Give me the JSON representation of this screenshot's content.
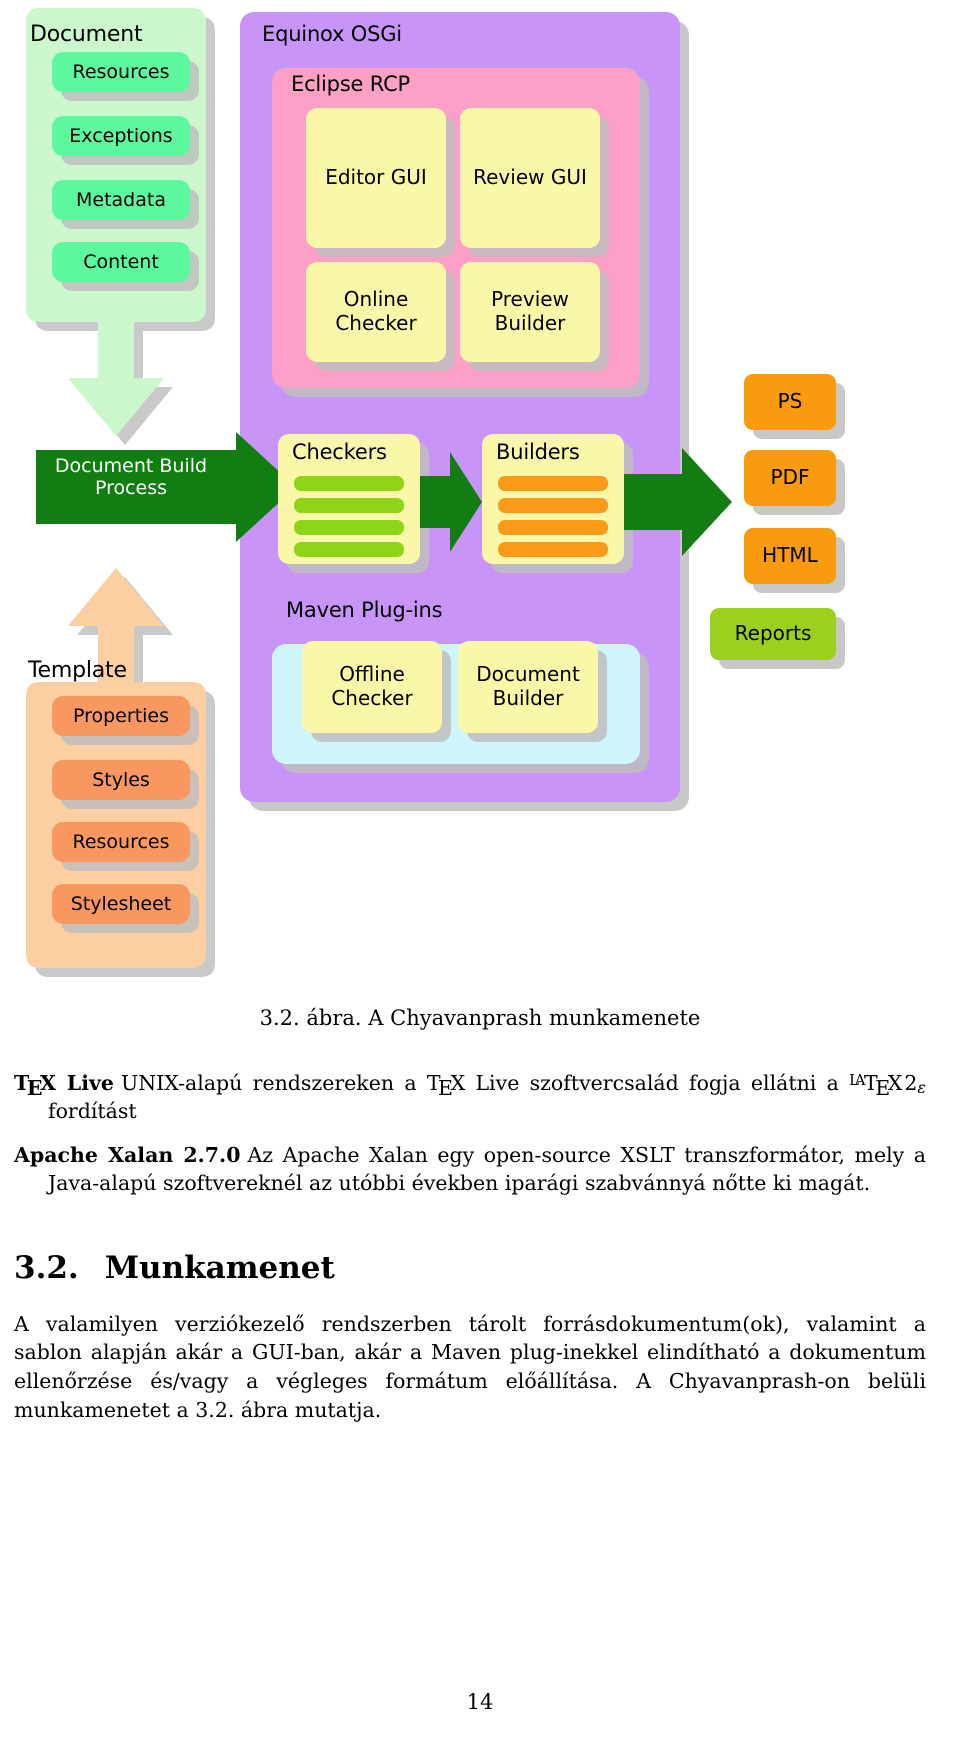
{
  "figure": {
    "groups": {
      "document": {
        "title": "Document",
        "items": [
          "Resources",
          "Exceptions",
          "Metadata",
          "Content"
        ],
        "fill": "#ccf7cc",
        "item_fill": "#5df79e"
      },
      "template": {
        "title": "Template",
        "items": [
          "Properties",
          "Styles",
          "Resources",
          "Stylesheet"
        ],
        "fill": "#fbcfa2",
        "item_fill": "#f89860"
      },
      "osgi": {
        "title": "Equinox OSGi",
        "fill": "#c894f7"
      },
      "rcp": {
        "title": "Eclipse RCP",
        "fill": "#fda0c8",
        "items": [
          "Editor GUI",
          "Review GUI",
          "Online\nChecker",
          "Preview\nBuilder"
        ]
      },
      "maven": {
        "title": "Maven Plug-ins",
        "fill": "#cdf5fb",
        "items": [
          "Offline\nChecker",
          "Document\nBuilder"
        ]
      }
    },
    "cards": {
      "checkers": {
        "title": "Checkers",
        "stripe_count": 4,
        "stripe_color": "#8fd419"
      },
      "builders": {
        "title": "Builders",
        "stripe_count": 4,
        "stripe_color": "#fb9a18"
      }
    },
    "arrows": {
      "build_process": {
        "label_line1": "Document Build",
        "label_line2": "Process",
        "color": "#127d12"
      },
      "down_arrow_color": "#ccf7cc",
      "up_arrow_color": "#fbcfa2"
    },
    "outputs": {
      "formats": [
        "PS",
        "PDF",
        "HTML"
      ],
      "format_fill": "#fa9a0e",
      "reports": "Reports",
      "reports_fill": "#9dcf1f"
    }
  },
  "caption": {
    "number": "3.2. ábra.",
    "text": "A Chyavanprash munkamenete"
  },
  "definitions": [
    {
      "term_pre": "T",
      "term_mid": "E",
      "term_post": "X Live",
      "term_plain": "TeX Live",
      "body_before_latex": "UNIX-alapú rendszereken a ",
      "inline_tex": "TeX",
      "body_mid": " Live szoftvercsalád fogja ellátni a ",
      "inline_latex": "LaTeX 2ε",
      "body_after": " fordítást"
    },
    {
      "term_plain": "Apache Xalan 2.7.0",
      "body": "Az Apache Xalan egy open-source XSLT transzformátor, mely a Java-alapú szoftvereknél az utóbbi években iparági szabvánnyá nőtte ki magát."
    }
  ],
  "section": {
    "number": "3.2.",
    "title": "Munkamenet",
    "paragraph": "A valamilyen verziókezelő rendszerben tárolt forrásdokumentum(ok), valamint a sablon alapján akár a GUI-ban, akár a Maven plug-inekkel elindítható a dokumentum ellenőrzése és/vagy a végleges formátum előállítása. A Chyavanprash-on belüli munkamenetet a 3.2. ábra mutatja."
  },
  "page_number": "14"
}
